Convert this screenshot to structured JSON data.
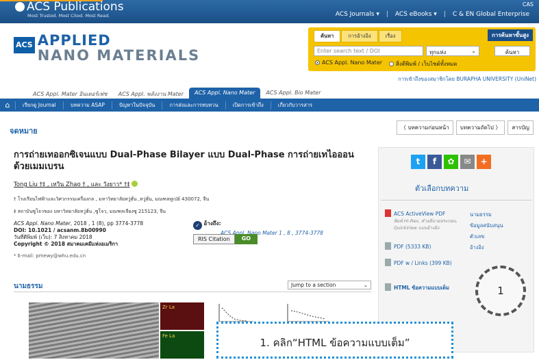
{
  "header": {
    "logo_name": "ACS Publications",
    "logo_tagline": "Most Trusted. Most Cited. Most Read.",
    "links": [
      "ACS Journals ▾",
      "ACS eBooks ▾",
      "C & EN Global Enterprise"
    ],
    "cas_label": "CAS"
  },
  "brand": {
    "acs": "ACS",
    "line1": "APPLIED",
    "line2": "NANO MATERIALS"
  },
  "search": {
    "tabs": [
      "ค้นหา",
      "การอ้างอิง",
      "เรื่อง"
    ],
    "advanced": "การค้นหาขั้นสูง",
    "placeholder": "Enter search text / DOI",
    "scope_value": "ทุกแห่ง",
    "button": "ค้นหา",
    "radio1": "ACS Appl. Nano Mater",
    "radio2": "สิ่งตีพิมพ์ / เว็บไซต์ทั้งหมด"
  },
  "access_note": "การเข้าถึงของสมาชิกโดย BURAPHA UNIVERSITY (UniNet)",
  "journal_tabs": [
    "ACS Appl. Mater อินเตอร์เฟซ",
    "ACS Appl. พลังงาน Mater",
    "ACS Appl. Nano Mater",
    "ACS Appl. Bio Mater"
  ],
  "nav": [
    "เรียกดู Journal",
    "บทความ ASAP",
    "ปัญหาในปัจจุบัน",
    "การส่งและการทบทวน",
    "เปิดการเข้าถึง",
    "เกี่ยวกับวารสาร"
  ],
  "article": {
    "type": "จดหมาย",
    "prev": "〈 บทความก่อนหน้า",
    "next": "บทความถัดไป 〉",
    "toc": "สารบัญ",
    "title": "การถ่ายเทออกซิเจนแบบ Dual-Phase Bilayer แบบ Dual-Phase การถ่ายเทไอออนด้วยเมมเบรน",
    "authors": "Tong Liu †‡ , เหวิน Zhao † , และ วังยาว* †‡",
    "aff1": "† โรงเรียนไฟฟ้าและวิศวกรรมเครื่องกล , มหาวิทยาลัยหวู่ฮั่น ,หวู่ฮั่น, มณฑลหูเป่ย์ 430072, จีน",
    "aff2": "‡ สถาบันซูโจวของ มหาวิทยาลัยหวู่ฮั่น ,ซูโจว, มณฑลเจียงซู 215123, จีน",
    "cite_journal": "ACS Appl. Nano Mater",
    "cite_rest": ", 2018 , 1 (8), pp 3774-3778",
    "doi": "DOI: 10.1021 / acsanm.8b00990",
    "pubdate": "วันที่ตีพิมพ์ (เว็บ): 7 สิงหาคม 2018",
    "copyright": "Copyright © 2018 สมาคมเคมีแห่งอเมริกา",
    "email": "* E-mail: pmewy@whu.edu.cn",
    "cite_label": "อ้างถึง:",
    "cite_text": "ACS Appl. Nano Mater 1 , 8 , 3774-3778",
    "ris": "RIS Citation",
    "go": "GO",
    "abstract": "นามธรรม",
    "jump": "Jump to a section",
    "fig_label1": "Zr La",
    "fig_label2": "Fe La"
  },
  "sidebar": {
    "options_title": "ตัวเลือกบทความ",
    "activeview": "ACS ActiveView PDF",
    "activeview_sub": "พิมพ์ Hi-Res, คำอธิบายประกอบ, QuickView แบบอ้างอิง",
    "pdf": "PDF (5333 KB)",
    "pdf_links": "PDF w / Links (399 KB)",
    "html": "HTML ข้อความแบบเต็ม",
    "right_links": [
      "นามธรรม",
      "ข้อมูลสนับสนุน",
      "ตัวเลข",
      "อ้างอิง"
    ]
  },
  "annotation": {
    "circle_number": "1",
    "callout": "1. คลิก“HTML ข้อความแบบเต็ม”"
  },
  "colors": {
    "brand_blue": "#1e62a8",
    "search_yellow": "#f5c400",
    "go_green": "#4a8c2a"
  }
}
